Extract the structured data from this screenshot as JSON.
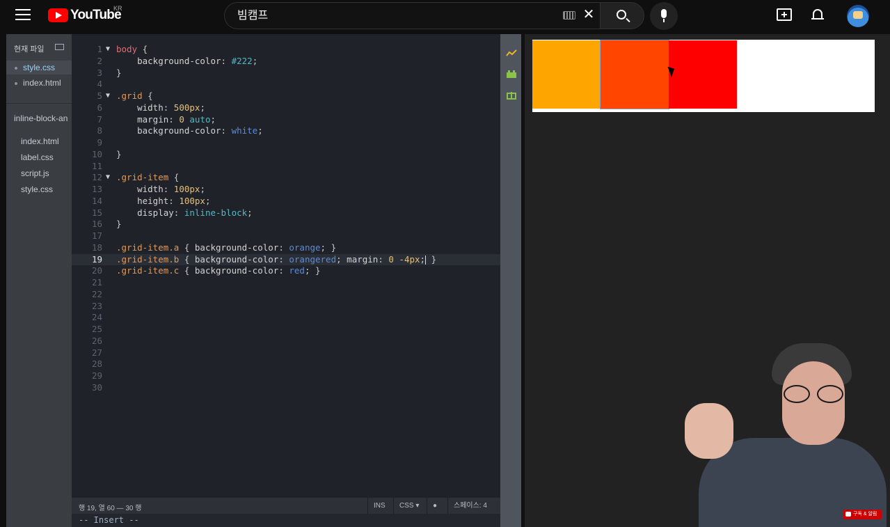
{
  "youtube": {
    "logo_text": "YouTube",
    "region": "KR",
    "search_value": "빔캠프"
  },
  "sidebar": {
    "header": "현재 파일",
    "open_files": [
      "style.css",
      "index.html"
    ],
    "project_name": "inline-block-an",
    "project_files": [
      "index.html",
      "label.css",
      "script.js",
      "style.css"
    ]
  },
  "editor": {
    "current_line": 19,
    "lines": [
      {
        "n": "1",
        "fold": "▼",
        "tokens": [
          [
            "c-sel-red",
            "body"
          ],
          [
            "c-punc",
            " {"
          ]
        ]
      },
      {
        "n": "2",
        "tokens": [
          [
            "c-prop",
            "    background-color"
          ],
          [
            "c-punc",
            ": "
          ],
          [
            "c-kw",
            "#222"
          ],
          [
            "c-punc",
            ";"
          ]
        ]
      },
      {
        "n": "3",
        "tokens": [
          [
            "c-punc",
            "}"
          ]
        ]
      },
      {
        "n": "4",
        "tokens": []
      },
      {
        "n": "5",
        "fold": "▼",
        "tokens": [
          [
            "c-sel",
            ".grid"
          ],
          [
            "c-punc",
            " {"
          ]
        ]
      },
      {
        "n": "6",
        "tokens": [
          [
            "c-prop",
            "    width"
          ],
          [
            "c-punc",
            ": "
          ],
          [
            "c-num",
            "500px"
          ],
          [
            "c-punc",
            ";"
          ]
        ]
      },
      {
        "n": "7",
        "tokens": [
          [
            "c-prop",
            "    margin"
          ],
          [
            "c-punc",
            ": "
          ],
          [
            "c-num",
            "0"
          ],
          [
            "c-punc",
            " "
          ],
          [
            "c-kw",
            "auto"
          ],
          [
            "c-punc",
            ";"
          ]
        ]
      },
      {
        "n": "8",
        "tokens": [
          [
            "c-prop",
            "    background-color"
          ],
          [
            "c-punc",
            ": "
          ],
          [
            "c-color",
            "white"
          ],
          [
            "c-punc",
            ";"
          ]
        ]
      },
      {
        "n": "9",
        "tokens": []
      },
      {
        "n": "10",
        "tokens": [
          [
            "c-punc",
            "}"
          ]
        ]
      },
      {
        "n": "11",
        "tokens": []
      },
      {
        "n": "12",
        "fold": "▼",
        "tokens": [
          [
            "c-sel",
            ".grid-item"
          ],
          [
            "c-punc",
            " {"
          ]
        ]
      },
      {
        "n": "13",
        "tokens": [
          [
            "c-prop",
            "    width"
          ],
          [
            "c-punc",
            ": "
          ],
          [
            "c-num",
            "100px"
          ],
          [
            "c-punc",
            ";"
          ]
        ]
      },
      {
        "n": "14",
        "tokens": [
          [
            "c-prop",
            "    height"
          ],
          [
            "c-punc",
            ": "
          ],
          [
            "c-num",
            "100px"
          ],
          [
            "c-punc",
            ";"
          ]
        ]
      },
      {
        "n": "15",
        "tokens": [
          [
            "c-prop",
            "    display"
          ],
          [
            "c-punc",
            ": "
          ],
          [
            "c-kw",
            "inline-block"
          ],
          [
            "c-punc",
            ";"
          ]
        ]
      },
      {
        "n": "16",
        "tokens": [
          [
            "c-punc",
            "}"
          ]
        ]
      },
      {
        "n": "17",
        "tokens": []
      },
      {
        "n": "18",
        "tokens": [
          [
            "c-sel",
            ".grid-item.a"
          ],
          [
            "c-punc",
            " { "
          ],
          [
            "c-prop",
            "background-color"
          ],
          [
            "c-punc",
            ": "
          ],
          [
            "c-color",
            "orange"
          ],
          [
            "c-punc",
            "; }"
          ]
        ]
      },
      {
        "n": "19",
        "tokens": [
          [
            "c-sel",
            ".grid-item.b"
          ],
          [
            "c-punc",
            " { "
          ],
          [
            "c-prop",
            "background-color"
          ],
          [
            "c-punc",
            ": "
          ],
          [
            "c-color",
            "orangered"
          ],
          [
            "c-punc",
            "; "
          ],
          [
            "c-prop",
            "margin"
          ],
          [
            "c-punc",
            ": "
          ],
          [
            "c-num",
            "0 -4px"
          ],
          [
            "c-punc",
            ";"
          ],
          [
            "cursor",
            ""
          ],
          [
            "c-punc",
            " }"
          ]
        ]
      },
      {
        "n": "20",
        "tokens": [
          [
            "c-sel",
            ".grid-item.c"
          ],
          [
            "c-punc",
            " { "
          ],
          [
            "c-prop",
            "background-color"
          ],
          [
            "c-punc",
            ": "
          ],
          [
            "c-color",
            "red"
          ],
          [
            "c-punc",
            "; }"
          ]
        ]
      },
      {
        "n": "21",
        "tokens": []
      },
      {
        "n": "22",
        "tokens": []
      },
      {
        "n": "23",
        "tokens": []
      },
      {
        "n": "24",
        "tokens": []
      },
      {
        "n": "25",
        "tokens": []
      },
      {
        "n": "26",
        "tokens": []
      },
      {
        "n": "27",
        "tokens": []
      },
      {
        "n": "28",
        "tokens": []
      },
      {
        "n": "29",
        "tokens": []
      },
      {
        "n": "30",
        "tokens": []
      }
    ]
  },
  "status": {
    "position": "행 19, 열 60 — 30 행",
    "ins": "INS",
    "language": "CSS ▾",
    "spaces": "스페이스: 4",
    "mode": "-- Insert --"
  },
  "preview": {
    "items": [
      {
        "name": "grid-item-a",
        "color": "#ffa500"
      },
      {
        "name": "grid-item-b",
        "color": "#ff4500"
      },
      {
        "name": "grid-item-c",
        "color": "#ff0000"
      }
    ]
  },
  "overlay": {
    "subscribe_badge": "구독 & 알림"
  }
}
